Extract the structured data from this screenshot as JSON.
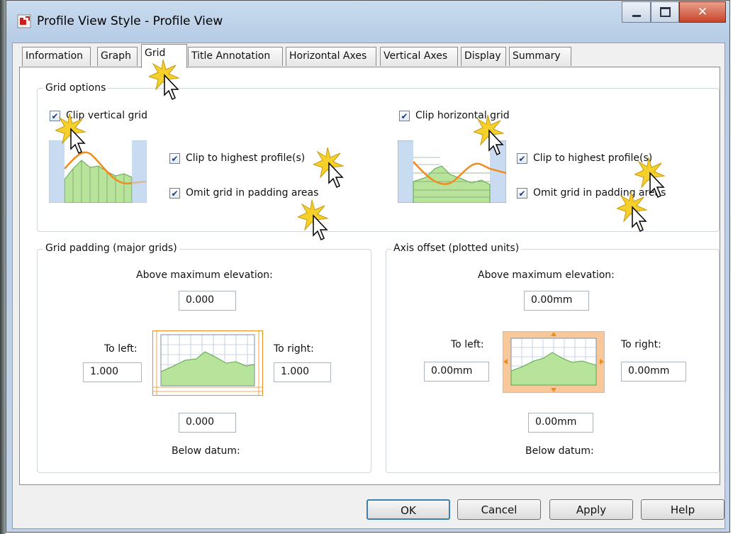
{
  "window": {
    "title": "Profile View Style - Profile View",
    "colors": {
      "accent": "#3c7fb1",
      "close": "#c8442a",
      "orange": "#f08c1e",
      "green": "#b8e39a"
    }
  },
  "tabs": [
    {
      "label": "Information"
    },
    {
      "label": "Graph"
    },
    {
      "label": "Grid"
    },
    {
      "label": "Title Annotation"
    },
    {
      "label": "Horizontal Axes"
    },
    {
      "label": "Vertical Axes"
    },
    {
      "label": "Display"
    },
    {
      "label": "Summary"
    }
  ],
  "active_tab": "Grid",
  "grid_options": {
    "legend": "Grid options",
    "clip_vertical": {
      "label": "Clip vertical grid",
      "checked": true
    },
    "clip_horizontal": {
      "label": "Clip horizontal grid",
      "checked": true
    },
    "left_clip_highest": {
      "label": "Clip to highest profile(s)",
      "checked": true
    },
    "left_omit_padding": {
      "label": "Omit grid in padding areas",
      "checked": true
    },
    "right_clip_highest": {
      "label": "Clip to highest profile(s)",
      "checked": true
    },
    "right_omit_padding": {
      "label": "Omit grid in padding areas",
      "checked": true
    }
  },
  "grid_padding": {
    "legend": "Grid padding (major grids)",
    "above_label": "Above maximum elevation:",
    "above_value": "0.000",
    "left_label": "To left:",
    "left_value": "1.000",
    "right_label": "To right:",
    "right_value": "1.000",
    "below_value": "0.000",
    "below_label": "Below datum:"
  },
  "axis_offset": {
    "legend": "Axis offset (plotted units)",
    "above_label": "Above maximum elevation:",
    "above_value": "0.00mm",
    "left_label": "To left:",
    "left_value": "0.00mm",
    "right_label": "To right:",
    "right_value": "0.00mm",
    "below_value": "0.00mm",
    "below_label": "Below datum:"
  },
  "buttons": {
    "ok": "OK",
    "cancel": "Cancel",
    "apply": "Apply",
    "help": "Help"
  }
}
